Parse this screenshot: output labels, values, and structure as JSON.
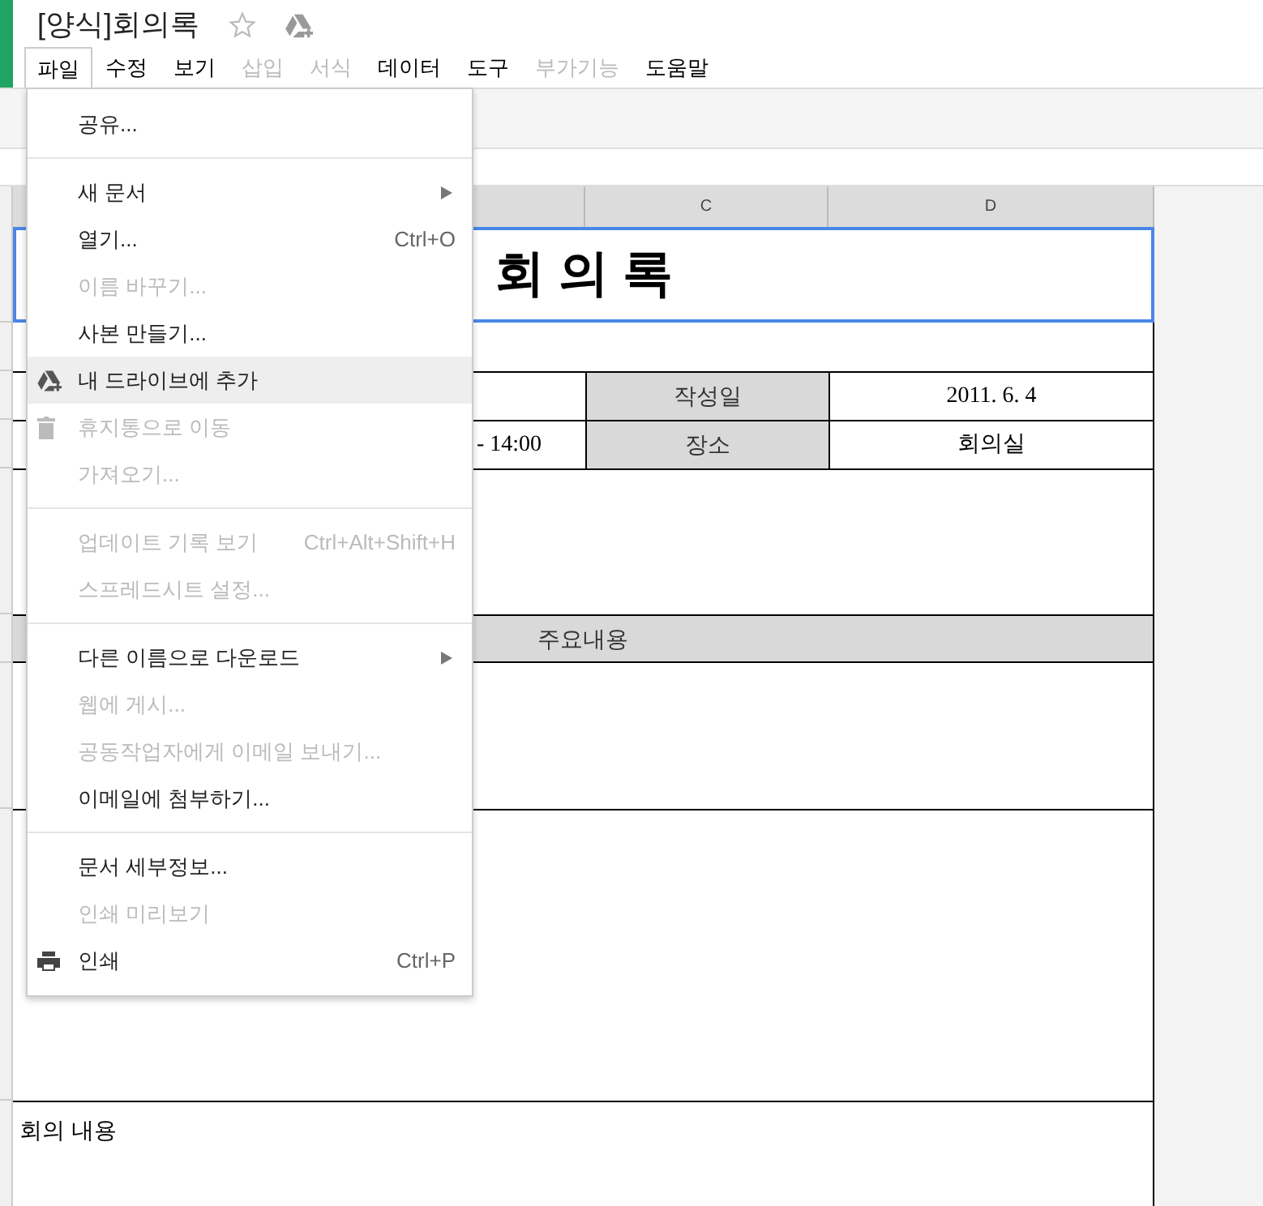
{
  "document": {
    "title": "[양식]회의록",
    "starred": false
  },
  "menubar": [
    {
      "label": "파일",
      "selected": true,
      "disabled": false
    },
    {
      "label": "수정",
      "selected": false,
      "disabled": false
    },
    {
      "label": "보기",
      "selected": false,
      "disabled": false
    },
    {
      "label": "삽입",
      "selected": false,
      "disabled": true
    },
    {
      "label": "서식",
      "selected": false,
      "disabled": true
    },
    {
      "label": "데이터",
      "selected": false,
      "disabled": false
    },
    {
      "label": "도구",
      "selected": false,
      "disabled": false
    },
    {
      "label": "부가기능",
      "selected": false,
      "disabled": true
    },
    {
      "label": "도움말",
      "selected": false,
      "disabled": false
    }
  ],
  "file_menu": {
    "sections": [
      [
        {
          "kind": "plain",
          "label": "공유...",
          "disabled": false,
          "highlighted": false
        }
      ],
      [
        {
          "kind": "plain",
          "label": "새 문서",
          "submenu": true,
          "disabled": false,
          "highlighted": false
        },
        {
          "kind": "plain",
          "label": "열기...",
          "shortcut": "Ctrl+O",
          "disabled": false,
          "highlighted": false
        },
        {
          "kind": "plain",
          "label": "이름 바꾸기...",
          "disabled": true,
          "highlighted": false
        },
        {
          "kind": "plain",
          "label": "사본 만들기...",
          "disabled": false,
          "highlighted": false
        },
        {
          "kind": "drive",
          "label": "내 드라이브에 추가",
          "disabled": false,
          "highlighted": true
        },
        {
          "kind": "trash",
          "label": "휴지통으로 이동",
          "disabled": true,
          "highlighted": false
        },
        {
          "kind": "plain",
          "label": "가져오기...",
          "disabled": true,
          "highlighted": false
        }
      ],
      [
        {
          "kind": "plain",
          "label": "업데이트 기록 보기",
          "shortcut": "Ctrl+Alt+Shift+H",
          "disabled": true,
          "highlighted": false
        },
        {
          "kind": "plain",
          "label": "스프레드시트 설정...",
          "disabled": true,
          "highlighted": false
        }
      ],
      [
        {
          "kind": "plain",
          "label": "다른 이름으로 다운로드",
          "submenu": true,
          "disabled": false,
          "highlighted": false
        },
        {
          "kind": "plain",
          "label": "웹에 게시...",
          "disabled": true,
          "highlighted": false
        },
        {
          "kind": "plain",
          "label": "공동작업자에게 이메일 보내기...",
          "disabled": true,
          "highlighted": false
        },
        {
          "kind": "plain",
          "label": "이메일에 첨부하기...",
          "disabled": false,
          "highlighted": false
        }
      ],
      [
        {
          "kind": "plain",
          "label": "문서 세부정보...",
          "disabled": false,
          "highlighted": false
        },
        {
          "kind": "plain",
          "label": "인쇄 미리보기",
          "disabled": true,
          "highlighted": false
        },
        {
          "kind": "print",
          "label": "인쇄",
          "shortcut": "Ctrl+P",
          "disabled": false,
          "highlighted": false
        }
      ]
    ]
  },
  "sheet": {
    "column_headers": [
      "C",
      "D"
    ],
    "title_cell": "회 의 록",
    "info_rows": [
      {
        "column_2": null,
        "label": "작성일",
        "value": "2011. 6. 4"
      },
      {
        "column_2": "- 14:00",
        "label": "장소",
        "value": "회의실"
      }
    ],
    "section_header": "주요내용",
    "notes_label": "회의 내용"
  }
}
